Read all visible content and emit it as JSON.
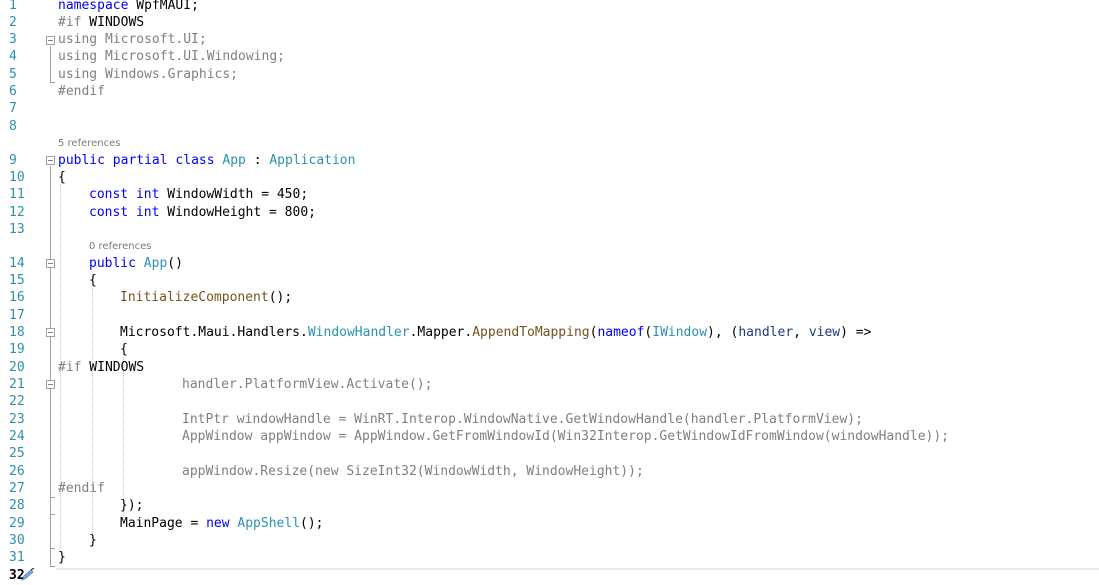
{
  "editor": {
    "line_numbers": [
      "1",
      "2",
      "3",
      "4",
      "5",
      "6",
      "7",
      "8",
      "9",
      "10",
      "11",
      "12",
      "13",
      "14",
      "15",
      "16",
      "17",
      "18",
      "19",
      "20",
      "21",
      "22",
      "23",
      "24",
      "25",
      "26",
      "27",
      "28",
      "29",
      "30",
      "31",
      "32"
    ],
    "code_lens": {
      "class_refs": "5 references",
      "ctor_refs": "0 references"
    },
    "lines": {
      "l1": [
        "namespace",
        " WpfMAUI;"
      ],
      "l2": [
        "#if",
        " WINDOWS"
      ],
      "l3": "using Microsoft.UI;",
      "l4": "using Microsoft.UI.Windowing;",
      "l5": "using Windows.Graphics;",
      "l6": "#endif",
      "l9": [
        "public",
        " ",
        "partial",
        " ",
        "class",
        " ",
        "App",
        " : ",
        "Application"
      ],
      "l10": "{",
      "l11": [
        "const",
        " ",
        "int",
        " WindowWidth = 450;"
      ],
      "l12": [
        "const",
        " ",
        "int",
        " WindowHeight = 800;"
      ],
      "l14": [
        "public",
        " ",
        "App",
        "()"
      ],
      "l15": "{",
      "l16": [
        "InitializeComponent",
        "();"
      ],
      "l18": [
        "Microsoft.Maui.Handlers.",
        "WindowHandler",
        ".Mapper.",
        "AppendToMapping",
        "(",
        "nameof",
        "(",
        "IWindow",
        "), (",
        "handler",
        ", ",
        "view",
        ") =>"
      ],
      "l19": "{",
      "l20": [
        "#if",
        " WINDOWS"
      ],
      "l21": "handler.PlatformView.Activate();",
      "l23": "IntPtr windowHandle = WinRT.Interop.WindowNative.GetWindowHandle(handler.PlatformView);",
      "l24": "AppWindow appWindow = AppWindow.GetFromWindowId(Win32Interop.GetWindowIdFromWindow(windowHandle));",
      "l26": "appWindow.Resize(new SizeInt32(WindowWidth, WindowHeight));",
      "l27": "#endif",
      "l28": "});",
      "l29": [
        "MainPage = ",
        "new",
        " ",
        "AppShell",
        "();"
      ],
      "l30": "}",
      "l31": "}"
    },
    "colors": {
      "keyword": "#0000ff",
      "type": "#2b91af",
      "method": "#74531f",
      "inactive": "#808080",
      "parameter": "#1f377f",
      "line_number": "#2b91af"
    }
  }
}
